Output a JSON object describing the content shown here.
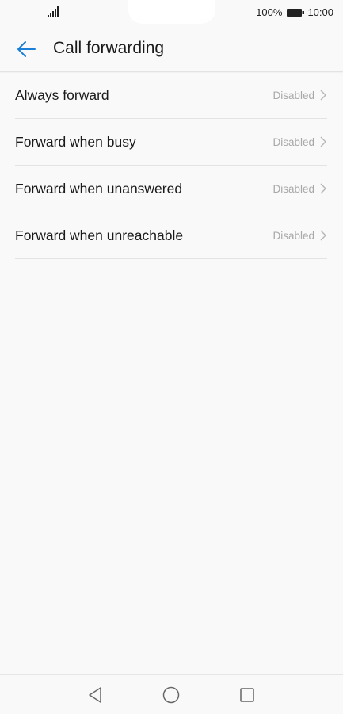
{
  "status_bar": {
    "battery_percent": "100%",
    "time": "10:00",
    "icons": [
      "signal-icon",
      "battery-icon"
    ]
  },
  "app_bar": {
    "title": "Call forwarding",
    "back_icon": "arrow-left-icon"
  },
  "colors": {
    "accent": "#1a7fd6",
    "divider": "#e3e3e3",
    "secondary_text": "#a8a8a8",
    "background": "#f9f9f9"
  },
  "items": [
    {
      "label": "Always forward",
      "status": "Disabled"
    },
    {
      "label": "Forward when busy",
      "status": "Disabled"
    },
    {
      "label": "Forward when unanswered",
      "status": "Disabled"
    },
    {
      "label": "Forward when unreachable",
      "status": "Disabled"
    }
  ],
  "nav_bar": {
    "icons": [
      "nav-back-icon",
      "nav-home-icon",
      "nav-recents-icon"
    ]
  }
}
